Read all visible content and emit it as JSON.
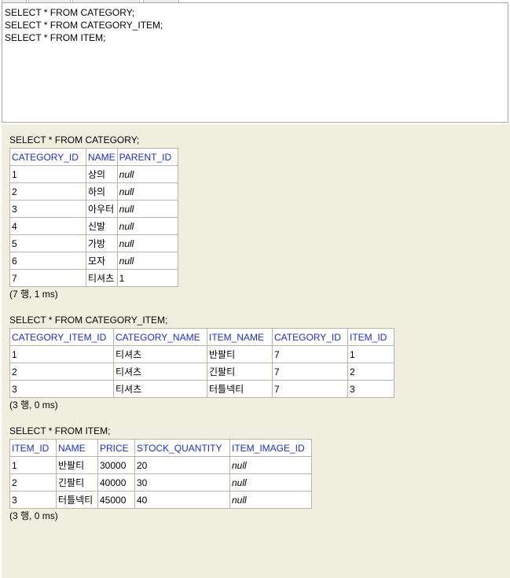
{
  "editor": {
    "lines": [
      "SELECT * FROM CATEGORY;",
      "SELECT * FROM CATEGORY_ITEM;",
      "SELECT * FROM ITEM;"
    ]
  },
  "results": [
    {
      "statement": "SELECT * FROM CATEGORY;",
      "columns": [
        "CATEGORY_ID",
        "NAME",
        "PARENT_ID"
      ],
      "rows": [
        [
          "1",
          "상의",
          "null"
        ],
        [
          "2",
          "하의",
          "null"
        ],
        [
          "3",
          "아우터",
          "null"
        ],
        [
          "4",
          "신발",
          "null"
        ],
        [
          "5",
          "가방",
          "null"
        ],
        [
          "6",
          "모자",
          "null"
        ],
        [
          "7",
          "티셔츠",
          "1"
        ]
      ],
      "footer": "(7 행, 1 ms)"
    },
    {
      "statement": "SELECT * FROM CATEGORY_ITEM;",
      "columns": [
        "CATEGORY_ITEM_ID",
        "CATEGORY_NAME",
        "ITEM_NAME",
        "CATEGORY_ID",
        "ITEM_ID"
      ],
      "rows": [
        [
          "1",
          "티셔츠",
          "반팔티",
          "7",
          "1"
        ],
        [
          "2",
          "티셔츠",
          "긴팔티",
          "7",
          "2"
        ],
        [
          "3",
          "티셔츠",
          "터틀넥티",
          "7",
          "3"
        ]
      ],
      "footer": "(3 행, 0 ms)"
    },
    {
      "statement": "SELECT * FROM ITEM;",
      "columns": [
        "ITEM_ID",
        "NAME",
        "PRICE",
        "STOCK_QUANTITY",
        "ITEM_IMAGE_ID"
      ],
      "rows": [
        [
          "1",
          "반팔티",
          "30000",
          "20",
          "null"
        ],
        [
          "2",
          "긴팔티",
          "40000",
          "30",
          "null"
        ],
        [
          "3",
          "터틀넥티",
          "45000",
          "40",
          "null"
        ]
      ],
      "footer": "(3 행, 0 ms)"
    }
  ],
  "colors": {
    "header_text": "#1a2fd0",
    "result_bg": "#f0eedf",
    "border": "#b9b5a7"
  }
}
